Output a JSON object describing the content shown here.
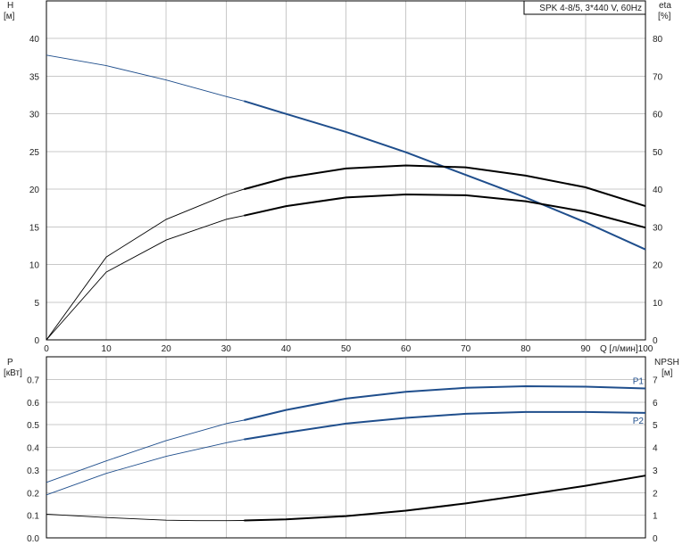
{
  "model_label": "SPK 4-8/5, 3*440 V, 60Hz",
  "colors": {
    "blue": "#1f4e8c",
    "black": "#000000",
    "grid": "#c8c8c8"
  },
  "chart_data": [
    {
      "type": "line",
      "title": "",
      "xlabel": "Q [л/мин]",
      "x_ticks": [
        "0",
        "10",
        "20",
        "30",
        "40",
        "50",
        "60",
        "70",
        "80",
        "90",
        "100"
      ],
      "xlim": [
        0,
        100
      ],
      "ylabel_left": "H\n[м]",
      "ylabel_left_lines": [
        "H",
        "[м]"
      ],
      "ylim_left": [
        0,
        45
      ],
      "y_ticks_left": [
        "0",
        "5",
        "10",
        "15",
        "20",
        "25",
        "30",
        "35",
        "40"
      ],
      "ylabel_right_lines": [
        "eta",
        "[%]"
      ],
      "ylim_right": [
        0,
        90
      ],
      "y_ticks_right": [
        "0",
        "10",
        "20",
        "30",
        "40",
        "50",
        "60",
        "70",
        "80"
      ],
      "grid": true,
      "series": [
        {
          "role": "head",
          "axis": "left",
          "color": "#1f4e8c",
          "x": [
            0,
            10,
            20,
            30,
            33,
            40,
            50,
            60,
            70,
            80,
            90,
            100
          ],
          "y": [
            37.8,
            36.4,
            34.5,
            32.3,
            31.7,
            30.0,
            27.6,
            24.9,
            21.9,
            18.9,
            15.6,
            12.0
          ],
          "operating_range": [
            33,
            100
          ]
        },
        {
          "role": "efficiency-upper",
          "axis": "right",
          "color": "#000000",
          "x": [
            0,
            10,
            20,
            30,
            33,
            40,
            50,
            60,
            70,
            80,
            90,
            100
          ],
          "y": [
            0,
            22,
            32,
            38.5,
            40,
            43,
            45.5,
            46.3,
            45.8,
            43.6,
            40.5,
            35.5
          ],
          "operating_range": [
            33,
            100
          ]
        },
        {
          "role": "efficiency-lower",
          "axis": "right",
          "color": "#000000",
          "x": [
            0,
            10,
            20,
            30,
            33,
            40,
            50,
            60,
            70,
            80,
            90,
            100
          ],
          "y": [
            0,
            18,
            26.5,
            32,
            33,
            35.5,
            37.8,
            38.6,
            38.4,
            36.8,
            34,
            29.8
          ],
          "operating_range": [
            33,
            100
          ]
        }
      ]
    },
    {
      "type": "line",
      "title": "",
      "xlabel": "",
      "xlim": [
        0,
        100
      ],
      "ylabel_left_lines": [
        "P",
        "[кВт]"
      ],
      "ylim_left": [
        0,
        0.8
      ],
      "y_ticks_left": [
        "0.0",
        "0.1",
        "0.2",
        "0.3",
        "0.4",
        "0.5",
        "0.6",
        "0.7"
      ],
      "ylabel_right_lines": [
        "NPSH",
        "[м]"
      ],
      "ylim_right": [
        0,
        8
      ],
      "y_ticks_right": [
        "0",
        "1",
        "2",
        "3",
        "4",
        "5",
        "6",
        "7"
      ],
      "grid": true,
      "series": [
        {
          "name": "P1",
          "axis": "left",
          "color": "#1f4e8c",
          "x": [
            0,
            10,
            20,
            30,
            33,
            40,
            50,
            60,
            70,
            80,
            90,
            100
          ],
          "y": [
            0.245,
            0.34,
            0.43,
            0.505,
            0.52,
            0.565,
            0.615,
            0.645,
            0.663,
            0.67,
            0.668,
            0.66
          ],
          "operating_range": [
            33,
            100
          ]
        },
        {
          "name": "P2",
          "axis": "left",
          "color": "#1f4e8c",
          "x": [
            0,
            10,
            20,
            30,
            33,
            40,
            50,
            60,
            70,
            80,
            90,
            100
          ],
          "y": [
            0.19,
            0.285,
            0.36,
            0.42,
            0.435,
            0.465,
            0.505,
            0.53,
            0.548,
            0.556,
            0.556,
            0.552
          ],
          "operating_range": [
            33,
            100
          ]
        },
        {
          "role": "npsh",
          "axis": "right",
          "color": "#000000",
          "x": [
            0,
            10,
            20,
            25,
            30,
            33,
            40,
            50,
            60,
            70,
            80,
            90,
            100
          ],
          "y": [
            1.05,
            0.9,
            0.78,
            0.76,
            0.76,
            0.77,
            0.82,
            0.96,
            1.2,
            1.52,
            1.9,
            2.3,
            2.75
          ],
          "operating_range": [
            33,
            100
          ]
        }
      ]
    }
  ]
}
